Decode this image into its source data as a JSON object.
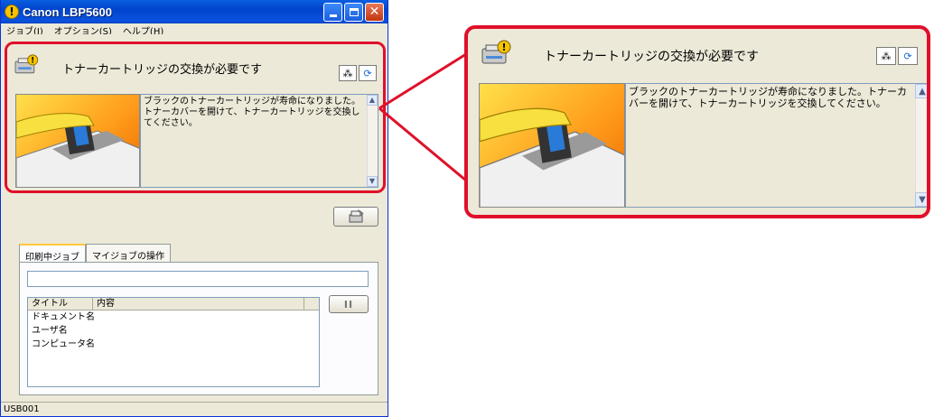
{
  "window": {
    "title": "Canon LBP5600",
    "alert_icon": "!",
    "menu": [
      "ジョブ(J)",
      "オプション(S)",
      "ヘルプ(H)"
    ]
  },
  "message": {
    "title": "トナーカートリッジの交換が必要です",
    "body": "ブラックのトナーカートリッジが寿命になりました。トナーカバーを開けて、トナーカートリッジを交換してください。"
  },
  "tabs": [
    "印刷中ジョブ",
    "マイジョブの操作"
  ],
  "job_table": {
    "columns": [
      "タイトル",
      "内容"
    ],
    "rows": [
      "ドキュメント名",
      "ユーザ名",
      "コンピュータ名"
    ]
  },
  "pause_button": "II",
  "statusbar": "USB001",
  "icons": {
    "alert": "alert-icon",
    "printer": "printer-warning-icon",
    "manual": "manual-icon",
    "refresh": "refresh-icon",
    "cleaning": "printer-cleaning-icon"
  },
  "colors": {
    "highlight": "#e0102a",
    "titlebar": "#0a5fe0",
    "window_bg": "#ece9d8"
  }
}
